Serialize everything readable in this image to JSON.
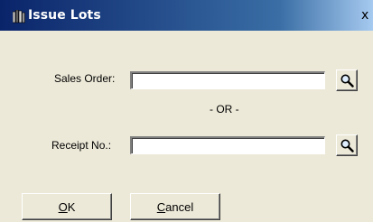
{
  "window": {
    "title": "Issue Lots",
    "icon": "books-icon",
    "close_glyph": "x"
  },
  "form": {
    "sales_order_label": "Sales Order:",
    "sales_order_value": "",
    "separator_text": "- OR -",
    "receipt_label": "Receipt No.:",
    "receipt_value": "",
    "lookup_icon": "magnifier-icon"
  },
  "buttons": {
    "ok_mnemonic": "O",
    "ok_rest": "K",
    "cancel_mnemonic": "C",
    "cancel_rest": "ancel"
  },
  "colors": {
    "titlebar_start": "#0a246a",
    "titlebar_end": "#a6caf0",
    "face": "#ece9d8"
  }
}
